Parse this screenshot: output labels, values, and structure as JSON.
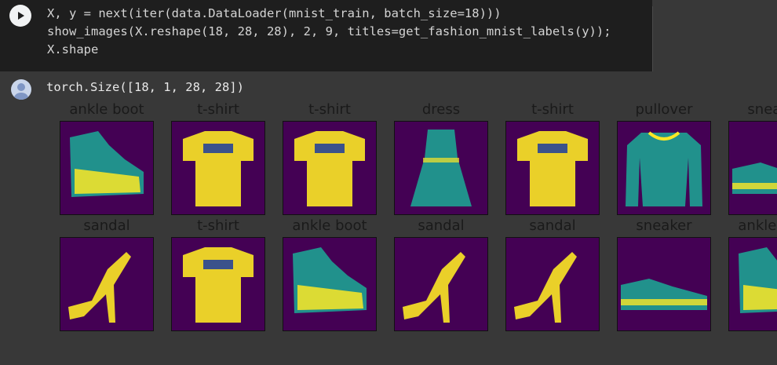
{
  "code_cell": {
    "lines": [
      "X, y = next(iter(data.DataLoader(mnist_train, batch_size=18)))",
      "show_images(X.reshape(18, 28, 28), 2, 9, titles=get_fashion_mnist_labels(y));",
      "X.shape"
    ],
    "run_icon": "play-icon"
  },
  "output": {
    "text": "torch.Size([18, 1, 28, 28])",
    "icon": "output-avatar-icon"
  },
  "colors": {
    "cell_background": "#383838",
    "code_background": "#1e1e1e",
    "image_background": "#440154",
    "image_foreground_dark": "#3b528b",
    "image_foreground_mid": "#21918c",
    "image_foreground_light": "#fde725"
  },
  "images": {
    "row1": [
      {
        "title": "ankle boot",
        "icon": "ankle-boot-image"
      },
      {
        "title": "t-shirt",
        "icon": "t-shirt-image"
      },
      {
        "title": "t-shirt",
        "icon": "t-shirt-image"
      },
      {
        "title": "dress",
        "icon": "dress-image"
      },
      {
        "title": "t-shirt",
        "icon": "t-shirt-image"
      },
      {
        "title": "pullover",
        "icon": "pullover-image"
      },
      {
        "title": "sneaker",
        "icon": "sneaker-image"
      }
    ],
    "row2": [
      {
        "title": "sandal",
        "icon": "sandal-image"
      },
      {
        "title": "t-shirt",
        "icon": "t-shirt-image"
      },
      {
        "title": "ankle boot",
        "icon": "ankle-boot-image"
      },
      {
        "title": "sandal",
        "icon": "sandal-image"
      },
      {
        "title": "sandal",
        "icon": "sandal-image"
      },
      {
        "title": "sneaker",
        "icon": "sneaker-image"
      },
      {
        "title": "ankle boot",
        "icon": "ankle-boot-image"
      }
    ]
  }
}
